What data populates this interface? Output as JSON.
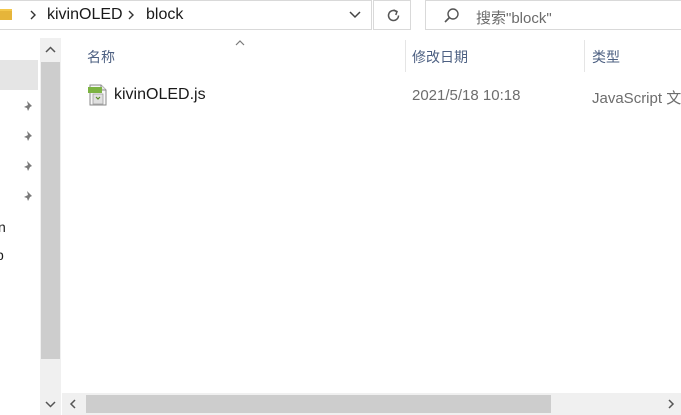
{
  "address": {
    "crumbs": [
      "kivinOLED",
      "block"
    ]
  },
  "search": {
    "placeholder": "搜索\"block\""
  },
  "columns": {
    "name": "名称",
    "date": "修改日期",
    "type": "类型"
  },
  "files": [
    {
      "name": "kivinOLED.js",
      "modified": "2021/5/18 10:18",
      "type": "JavaScript 文"
    }
  ],
  "nav": {
    "partial_labels": [
      "n",
      "p"
    ]
  }
}
